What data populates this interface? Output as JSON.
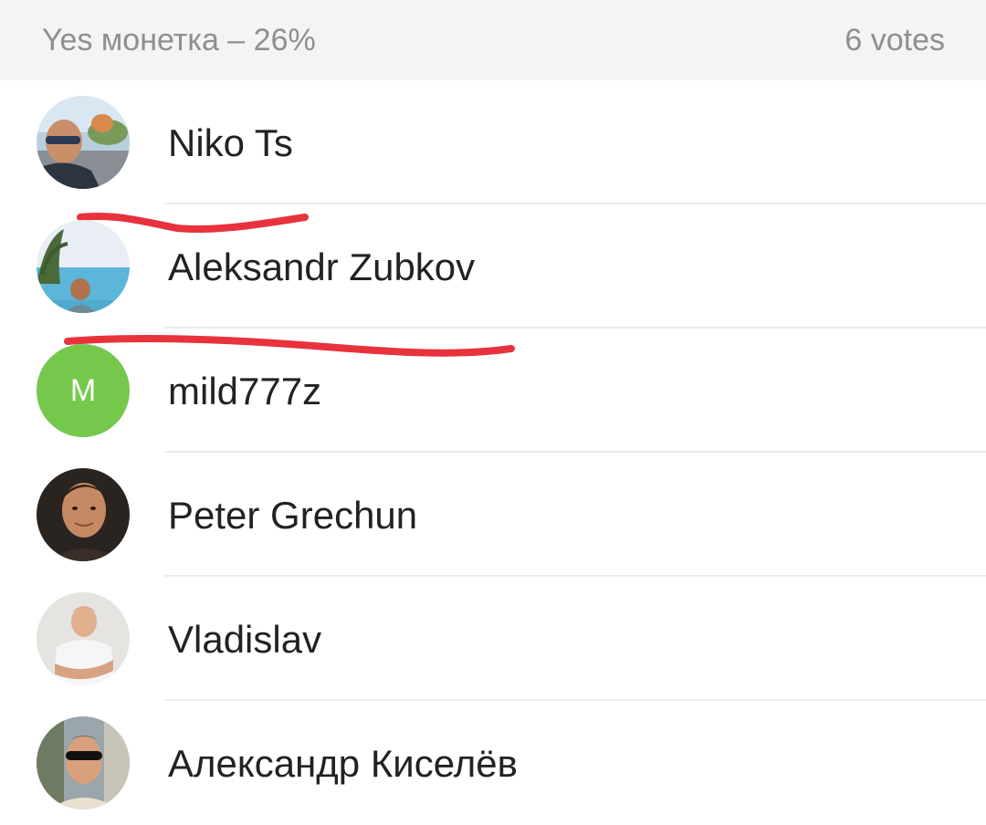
{
  "poll": {
    "option_label": "Yes монетка – 26%",
    "votes_label": "6 votes"
  },
  "voters": [
    {
      "name": "Niko Ts",
      "avatar": "photo-avatar"
    },
    {
      "name": "Aleksandr Zubkov",
      "avatar": "photo-avatar"
    },
    {
      "name": "mild777z",
      "avatar": "initial-avatar",
      "initial": "M"
    },
    {
      "name": "Peter Grechun",
      "avatar": "photo-avatar"
    },
    {
      "name": "Vladislav",
      "avatar": "photo-avatar"
    },
    {
      "name": "Александр Киселёв",
      "avatar": "photo-avatar"
    }
  ],
  "colors": {
    "strike": "#e8323c",
    "initial_avatar_bg": "#76c84d",
    "header_bg": "#f4f4f4",
    "header_text": "#8e8e93",
    "name_text": "#222222"
  }
}
